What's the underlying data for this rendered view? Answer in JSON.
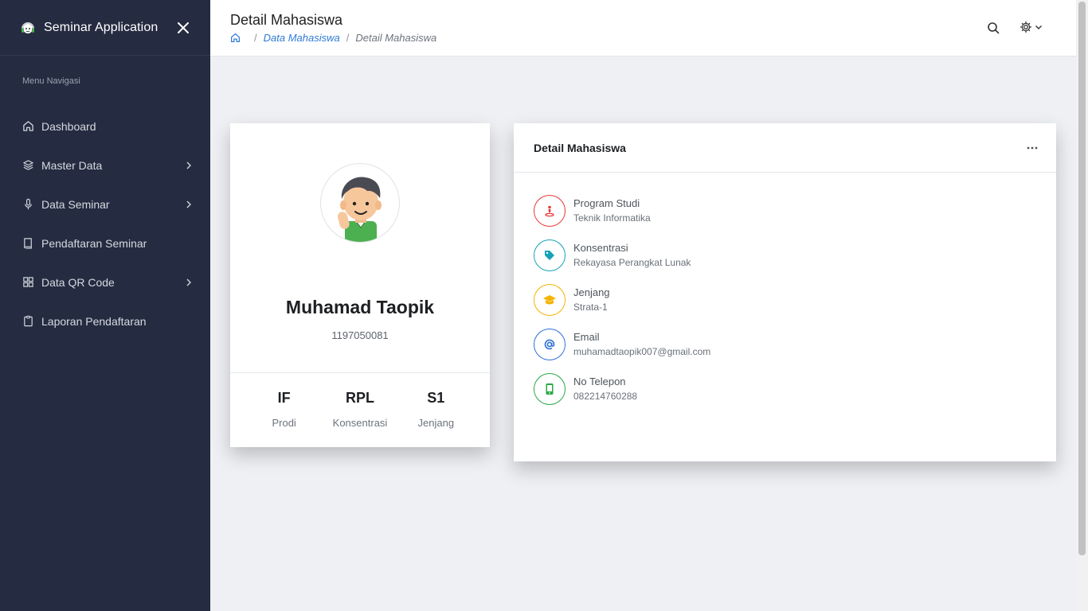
{
  "app": {
    "title": "Seminar Application"
  },
  "sidebar": {
    "heading": "Menu Navigasi",
    "items": [
      {
        "label": "Dashboard",
        "icon": "home-icon",
        "has_submenu": false
      },
      {
        "label": "Master Data",
        "icon": "layers-icon",
        "has_submenu": true
      },
      {
        "label": "Data Seminar",
        "icon": "microphone-icon",
        "has_submenu": true
      },
      {
        "label": "Pendaftaran Seminar",
        "icon": "book-icon",
        "has_submenu": false
      },
      {
        "label": "Data QR Code",
        "icon": "grid-icon",
        "has_submenu": true
      },
      {
        "label": "Laporan Pendaftaran",
        "icon": "clipboard-icon",
        "has_submenu": false
      }
    ]
  },
  "header": {
    "title": "Detail Mahasiswa",
    "breadcrumb": {
      "link": "Data Mahasiswa",
      "current": "Detail Mahasiswa"
    }
  },
  "profile": {
    "name": "Muhamad Taopik",
    "nim": "1197050081",
    "stats": [
      {
        "value": "IF",
        "label": "Prodi"
      },
      {
        "value": "RPL",
        "label": "Konsentrasi"
      },
      {
        "value": "S1",
        "label": "Jenjang"
      }
    ]
  },
  "detail": {
    "title": "Detail Mahasiswa",
    "rows": [
      {
        "label": "Program Studi",
        "value": "Teknik Informatika",
        "icon": "person-pin-icon",
        "color": "#e53935"
      },
      {
        "label": "Konsentrasi",
        "value": "Rekayasa Perangkat Lunak",
        "icon": "tag-icon",
        "color": "#17a2b8"
      },
      {
        "label": "Jenjang",
        "value": "Strata-1",
        "icon": "graduation-cap-icon",
        "color": "#f4b400"
      },
      {
        "label": "Email",
        "value": "muhamadtaopik007@gmail.com",
        "icon": "at-icon",
        "color": "#2f6fd6"
      },
      {
        "label": "No Telepon",
        "value": "082214760288",
        "icon": "phone-icon",
        "color": "#28a745"
      }
    ]
  },
  "colors": {
    "sidebar_bg": "#252c41",
    "link": "#2f7bd6",
    "page_bg": "#eef0f3"
  }
}
